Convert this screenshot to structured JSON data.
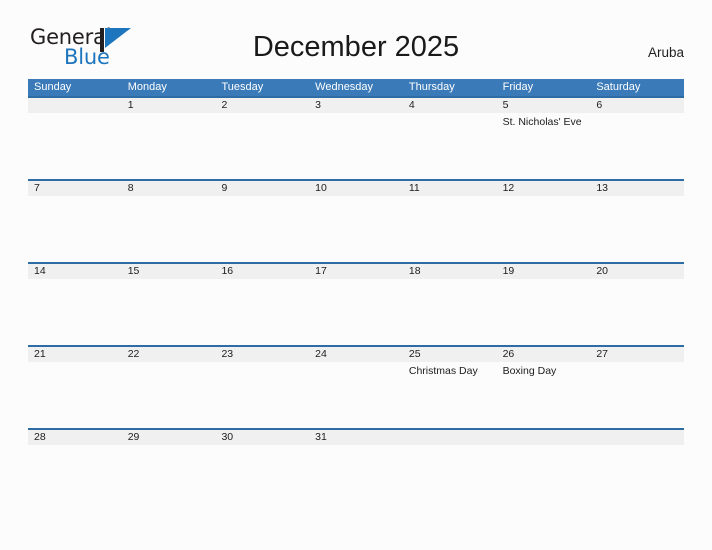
{
  "brand": {
    "name_line1": "General",
    "name_line2": "Blue",
    "mark": "flag-triangle-icon",
    "accent_color": "#1d75bd",
    "dark_color": "#231f20"
  },
  "header": {
    "title": "December 2025",
    "country": "Aruba"
  },
  "theme": {
    "header_blue": "#3a7ab8",
    "rule_blue": "#2e6da4",
    "number_band_gray": "#f0f0f0",
    "page_background": "#fcfcfc",
    "text_color": "#1c1c1c"
  },
  "calendar": {
    "month": "December",
    "year": "2025",
    "weekday_headers": [
      "Sunday",
      "Monday",
      "Tuesday",
      "Wednesday",
      "Thursday",
      "Friday",
      "Saturday"
    ],
    "weeks": [
      {
        "days": [
          {
            "number": "",
            "event": ""
          },
          {
            "number": "1",
            "event": ""
          },
          {
            "number": "2",
            "event": ""
          },
          {
            "number": "3",
            "event": ""
          },
          {
            "number": "4",
            "event": ""
          },
          {
            "number": "5",
            "event": "St. Nicholas' Eve"
          },
          {
            "number": "6",
            "event": ""
          }
        ]
      },
      {
        "days": [
          {
            "number": "7",
            "event": ""
          },
          {
            "number": "8",
            "event": ""
          },
          {
            "number": "9",
            "event": ""
          },
          {
            "number": "10",
            "event": ""
          },
          {
            "number": "11",
            "event": ""
          },
          {
            "number": "12",
            "event": ""
          },
          {
            "number": "13",
            "event": ""
          }
        ]
      },
      {
        "days": [
          {
            "number": "14",
            "event": ""
          },
          {
            "number": "15",
            "event": ""
          },
          {
            "number": "16",
            "event": ""
          },
          {
            "number": "17",
            "event": ""
          },
          {
            "number": "18",
            "event": ""
          },
          {
            "number": "19",
            "event": ""
          },
          {
            "number": "20",
            "event": ""
          }
        ]
      },
      {
        "days": [
          {
            "number": "21",
            "event": ""
          },
          {
            "number": "22",
            "event": ""
          },
          {
            "number": "23",
            "event": ""
          },
          {
            "number": "24",
            "event": ""
          },
          {
            "number": "25",
            "event": "Christmas Day"
          },
          {
            "number": "26",
            "event": "Boxing Day"
          },
          {
            "number": "27",
            "event": ""
          }
        ]
      },
      {
        "days": [
          {
            "number": "28",
            "event": ""
          },
          {
            "number": "29",
            "event": ""
          },
          {
            "number": "30",
            "event": ""
          },
          {
            "number": "31",
            "event": ""
          },
          {
            "number": "",
            "event": ""
          },
          {
            "number": "",
            "event": ""
          },
          {
            "number": "",
            "event": ""
          }
        ]
      }
    ]
  }
}
